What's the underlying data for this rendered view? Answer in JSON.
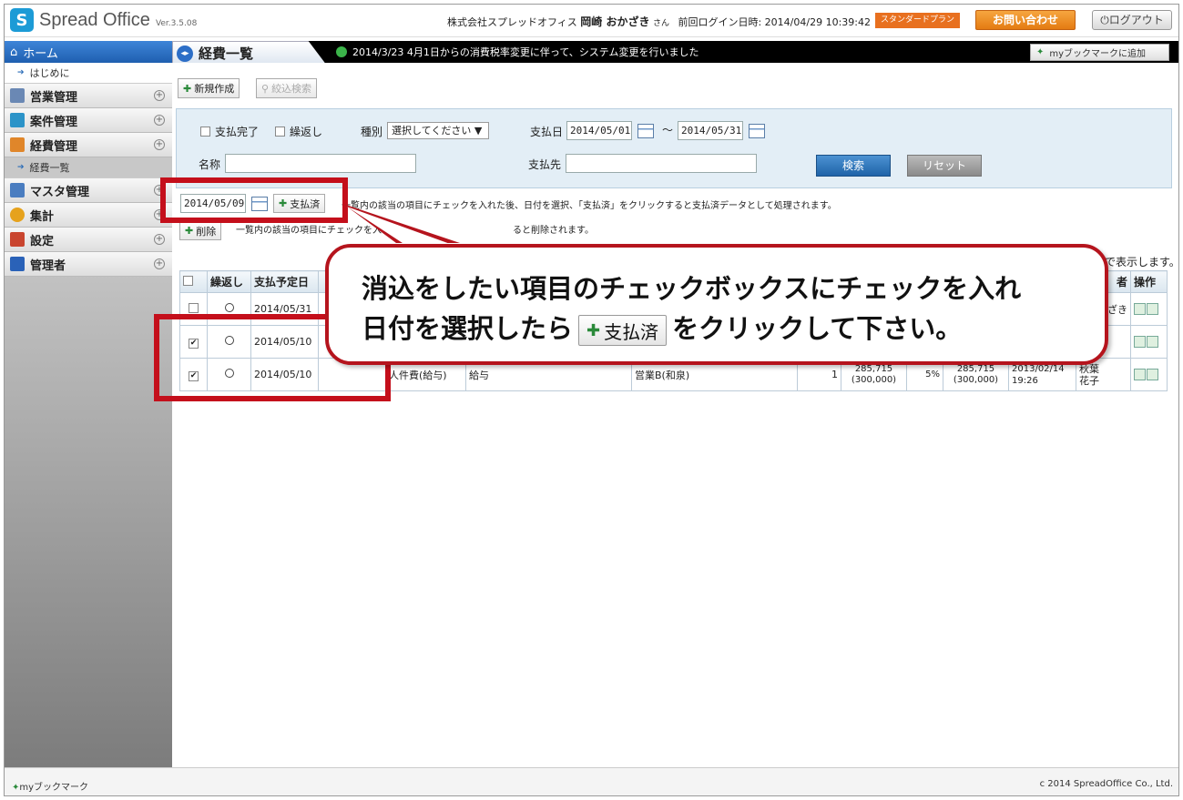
{
  "header": {
    "logo_mark": "S",
    "logo_text": "Spread Office",
    "version": "Ver.3.5.08",
    "company": "株式会社スプレッドオフィス",
    "user_name": "岡崎 おかざき",
    "user_suffix": "さん",
    "last_login": "前回ログイン日時: 2014/04/29 10:39:42",
    "plan": "スタンダードプラン",
    "contact": "お問い合わせ",
    "logout": "ログアウト"
  },
  "sidebar": {
    "home": "ホーム",
    "intro": "はじめに",
    "categories": [
      {
        "label": "営業管理",
        "color": "#6a88b4"
      },
      {
        "label": "案件管理",
        "color": "#2b93c8"
      },
      {
        "label": "経費管理",
        "color": "#e0862a"
      }
    ],
    "expense_sub": "経費一覧",
    "categories2": [
      {
        "label": "マスタ管理",
        "color": "#4a7dc0"
      },
      {
        "label": "集計",
        "color": "#e6a21d"
      },
      {
        "label": "設定",
        "color": "#c9452f"
      },
      {
        "label": "管理者",
        "color": "#2a62b8"
      }
    ]
  },
  "titlebar": {
    "title": "経費一覧",
    "news": "2014/3/23 4月1日からの消費税率変更に伴って、システム変更を行いました",
    "bookmark_add": "myブックマークに追加"
  },
  "toolbar": {
    "new": "新規作成",
    "filter": "絞込検索"
  },
  "search": {
    "paid_done": "支払完了",
    "repeat": "繰返し",
    "type_label": "種別",
    "type_value": "選択してください",
    "pay_date_label": "支払日",
    "date_from": "2014/05/01",
    "tilde": "〜",
    "date_to": "2014/05/31",
    "name_label": "名称",
    "payee_label": "支払先",
    "search_btn": "検索",
    "reset_btn": "リセット"
  },
  "bulk": {
    "paid_date": "2014/05/09",
    "paid_btn": "支払済",
    "paid_note": "一覧内の該当の項目にチェックを入れた後、日付を選択、「支払済」をクリックすると支払済データとして処理されます。",
    "delete_btn": "削除",
    "delete_note": "一覧内の該当の項目にチェックを入れ",
    "delete_note2": "ると削除されます。",
    "display_note": "で表示します。"
  },
  "table": {
    "headers": [
      "",
      "繰返し",
      "支払予定日"
    ],
    "right_headers": [
      "者",
      "操作"
    ],
    "rows": [
      {
        "checked": "",
        "date": "2014/05/31",
        "right_name": "ざき"
      },
      {
        "checked": "✔",
        "date": "2014/05/10",
        "right_name": ""
      },
      {
        "checked": "✔",
        "date": "2014/05/10",
        "cat": "人件費(給与)",
        "item": "給与",
        "dept": "営業B(和泉)",
        "qty": "1",
        "amt1": "285,715",
        "amt1b": "(300,000)",
        "tax": "5%",
        "amt2": "285,715",
        "amt2b": "(300,000)",
        "reg_date": "2013/02/14",
        "reg_time": "19:26",
        "person1": "秋葉",
        "person2": "花子"
      }
    ]
  },
  "callout": {
    "line1": "消込をしたい項目のチェックボックスにチェックを入れ",
    "line2_pre": "日付を選択したら",
    "btn": "支払済",
    "line2_post": "をクリックして下さい。"
  },
  "footer": {
    "bookmark": "myブックマーク",
    "copyright": "c 2014 SpreadOffice Co., Ltd."
  }
}
